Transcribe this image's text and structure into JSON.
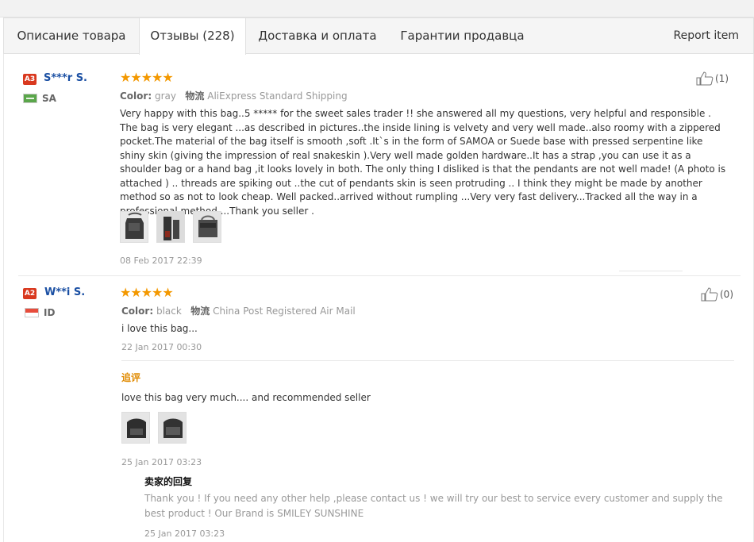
{
  "tabs": [
    {
      "label": "Описание товара"
    },
    {
      "label": "Отзывы (228)"
    },
    {
      "label": "Доставка и оплата"
    },
    {
      "label": "Гарантии продавца"
    }
  ],
  "report_label": "Report item",
  "reviews": [
    {
      "level": "A3",
      "name": "S***r S.",
      "country": "SA",
      "stars": "★★★★★",
      "color_label": "Color:",
      "color_value": "gray",
      "shipping_label": "物流",
      "shipping_value": "AliExpress Standard Shipping",
      "text": "Very happy with this bag..5 ***** for the sweet sales trader !! she answered all my questions, very helpful and responsible . The bag is very elegant ...as described in pictures..the inside lining is velvety and very well made..also roomy with a zippered pocket.The material of the bag itself is smooth ,soft .It`s in the form of SAMOA or Suede base with pressed serpentine like shiny skin (giving the impression of real snakeskin ).Very well made golden hardware..It has a strap ,you can use it as a shoulder bag or a hand bag ,it looks lovely in both. The only thing I disliked is that the pendants are not well made! (A photo is attached ) .. threads are spiking out ..the cut of pendants skin is seen protruding .. I think they might be made by another method so as not to look cheap. Well packed..arrived without rumpling ...Very very fast delivery...Tracked all the way in a professional method ...Thank you seller .",
      "date": "08 Feb 2017 22:39",
      "likes": "(1)"
    },
    {
      "level": "A2",
      "name": "W**i S.",
      "country": "ID",
      "stars": "★★★★★",
      "color_label": "Color:",
      "color_value": "black",
      "shipping_label": "物流",
      "shipping_value": "China Post Registered Air Mail",
      "text": "i love this bag...",
      "date": "22 Jan 2017 00:30",
      "likes": "(0)",
      "additional_label": "追评",
      "additional_text": "love this bag very much.... and recommended seller",
      "additional_date": "25 Jan 2017 03:23",
      "seller_reply_title": "卖家的回复",
      "seller_reply_text": "Thank you ! If you need any other help ,please contact us ! we will try our best to service every customer and supply the best product ! Our Brand is SMILEY SUNSHINE",
      "seller_reply_date": "25 Jan 2017 03:23"
    }
  ],
  "colors": {
    "accent": "#f39800",
    "badge": "#d9391f",
    "username": "#1a4fa3"
  }
}
